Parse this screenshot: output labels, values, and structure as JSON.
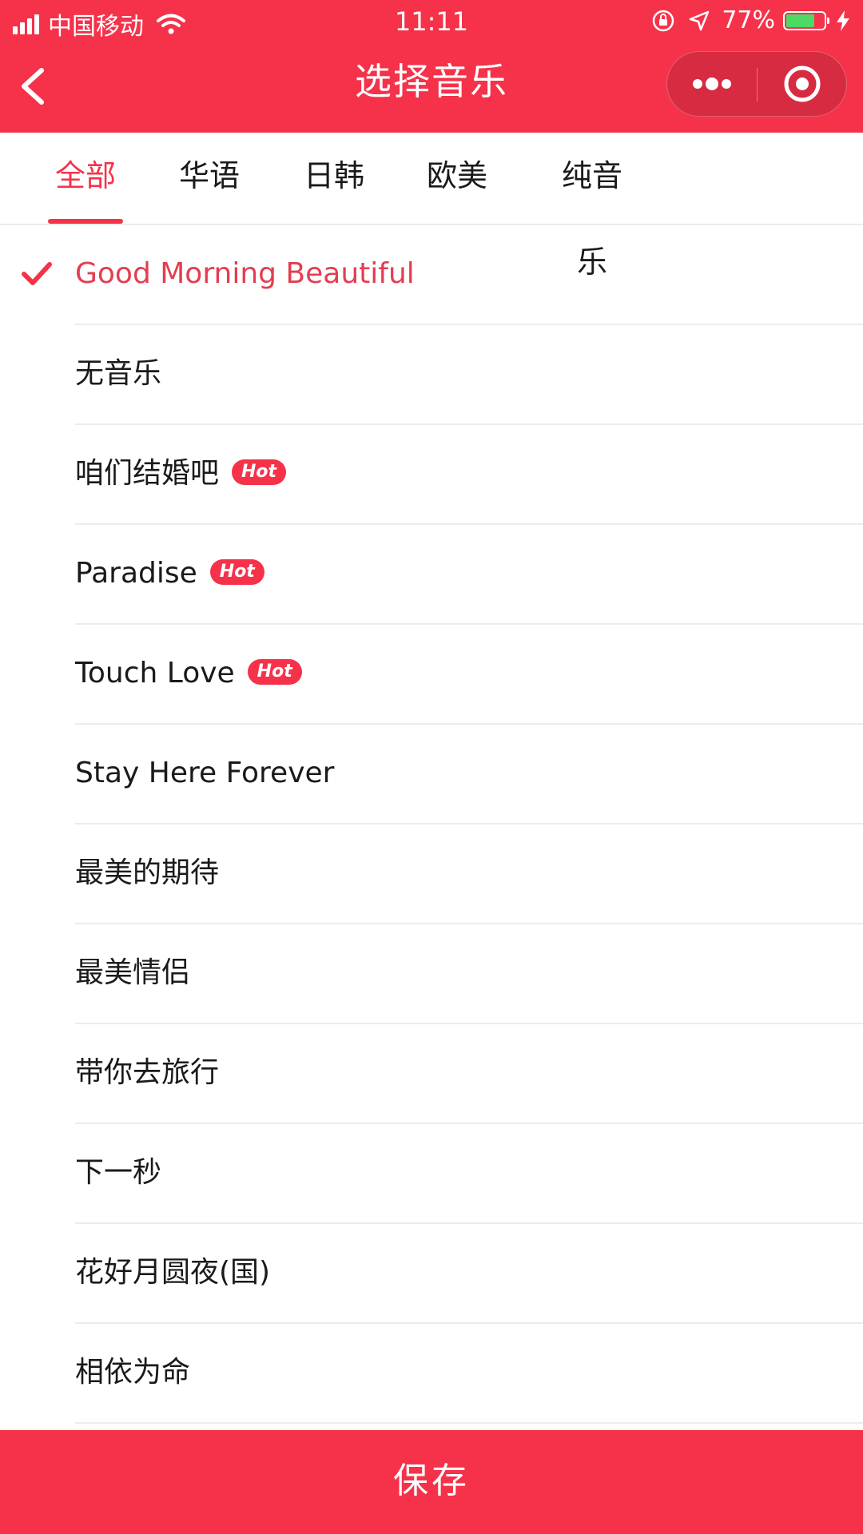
{
  "status_bar": {
    "carrier": "中国移动",
    "time": "11:11",
    "battery_percent": "77%",
    "battery_level": 0.77,
    "icons": [
      "signal-icon",
      "wifi-icon",
      "rotation-lock-icon",
      "location-icon",
      "battery-icon",
      "charging-icon"
    ]
  },
  "nav": {
    "title": "选择音乐",
    "back_icon": "back-chevron-icon",
    "more_icon": "more-dots-icon",
    "close_icon": "target-close-icon"
  },
  "tabs": [
    {
      "label": "全部",
      "active": true
    },
    {
      "label": "华语",
      "active": false
    },
    {
      "label": "日韩",
      "active": false
    },
    {
      "label": "欧美",
      "active": false
    },
    {
      "label": "纯音乐",
      "active": false
    }
  ],
  "songs": [
    {
      "title": "Good Morning Beautiful",
      "selected": true
    },
    {
      "title": "无音乐"
    },
    {
      "title": "咱们结婚吧",
      "hot": "Hot"
    },
    {
      "title": "Paradise",
      "hot": "Hot"
    },
    {
      "title": "Touch Love",
      "hot": "Hot"
    },
    {
      "title": "Stay Here Forever"
    },
    {
      "title": "最美的期待"
    },
    {
      "title": "最美情侣"
    },
    {
      "title": "带你去旅行"
    },
    {
      "title": "下一秒"
    },
    {
      "title": "花好月圆夜(国)"
    },
    {
      "title": "相依为命"
    }
  ],
  "footer": {
    "save_label": "保存"
  },
  "colors": {
    "accent": "#f5324a",
    "selected_text": "#e43d50",
    "divider": "#ececec",
    "battery_fill": "#4cd964"
  }
}
